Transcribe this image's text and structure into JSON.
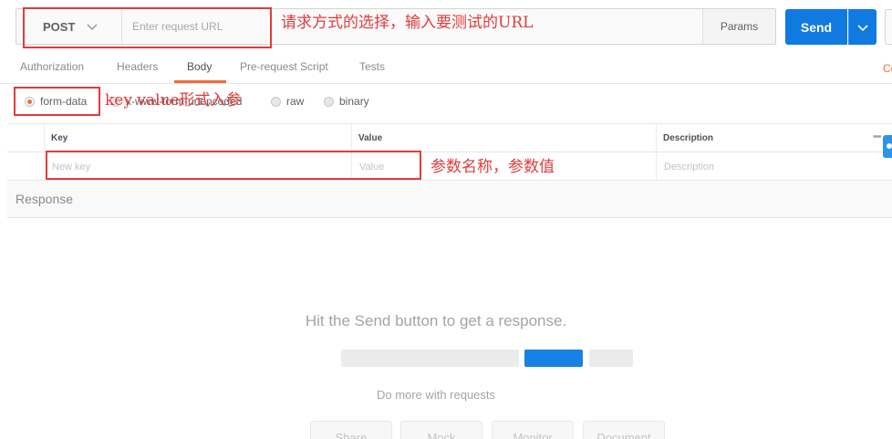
{
  "request": {
    "method": "POST",
    "url_placeholder": "Enter request URL",
    "params_label": "Params",
    "send_label": "Send"
  },
  "tabs": [
    {
      "label": "Authorization"
    },
    {
      "label": "Headers"
    },
    {
      "label": "Body"
    },
    {
      "label": "Pre-request Script"
    },
    {
      "label": "Tests"
    }
  ],
  "cookies_edge_text": "Co",
  "body_types": [
    {
      "label": "form-data",
      "selected": true
    },
    {
      "label": "x-www-form-urlencoded",
      "selected": false
    },
    {
      "label": "raw",
      "selected": false
    },
    {
      "label": "binary",
      "selected": false
    }
  ],
  "kv_table": {
    "headers": {
      "key": "Key",
      "value": "Value",
      "description": "Description"
    },
    "more_label": "•••",
    "placeholders": {
      "key": "New key",
      "value": "Value",
      "description": "Description"
    }
  },
  "response": {
    "title": "Response",
    "hint": "Hit the Send button to get a response.",
    "do_more": "Do more with requests",
    "actions": [
      "Share",
      "Mock",
      "Monitor",
      "Document"
    ]
  },
  "annotations": {
    "request": "请求方式的选择，输入要测试的URL",
    "form_data": "key value形式入参",
    "params": "参数名称，参数值"
  },
  "colors": {
    "accent": "#f26b3a",
    "send_blue": "#107ae0",
    "annotation_red": "#e23b3b"
  }
}
